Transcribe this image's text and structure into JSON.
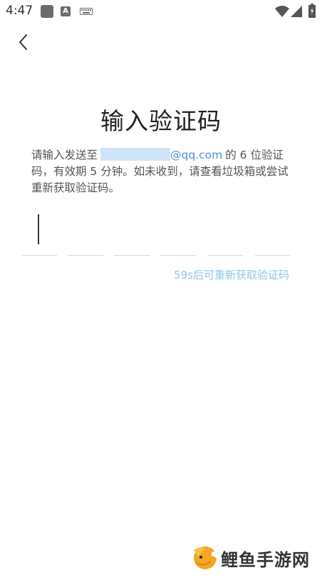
{
  "status_bar": {
    "time": "4:47",
    "keyboard_icon": "keyboard-icon",
    "a_badge": "A"
  },
  "header": {
    "back_icon": "chevron-left-icon"
  },
  "title": "输入验证码",
  "description": {
    "prefix": "请输入发送至",
    "email_domain": "@qq.com",
    "suffix": "的 6 位验证码，有效期 5 分钟。如未收到，请查看垃圾箱或尝试重新获取验证码。"
  },
  "code": {
    "length": 6,
    "active_index": 0
  },
  "resend_label": "59s后可重新获取验证码",
  "watermark": {
    "text": "鲤鱼手游网"
  },
  "colors": {
    "accent": "#4a90d9",
    "resend_disabled": "#8ec6e9"
  }
}
